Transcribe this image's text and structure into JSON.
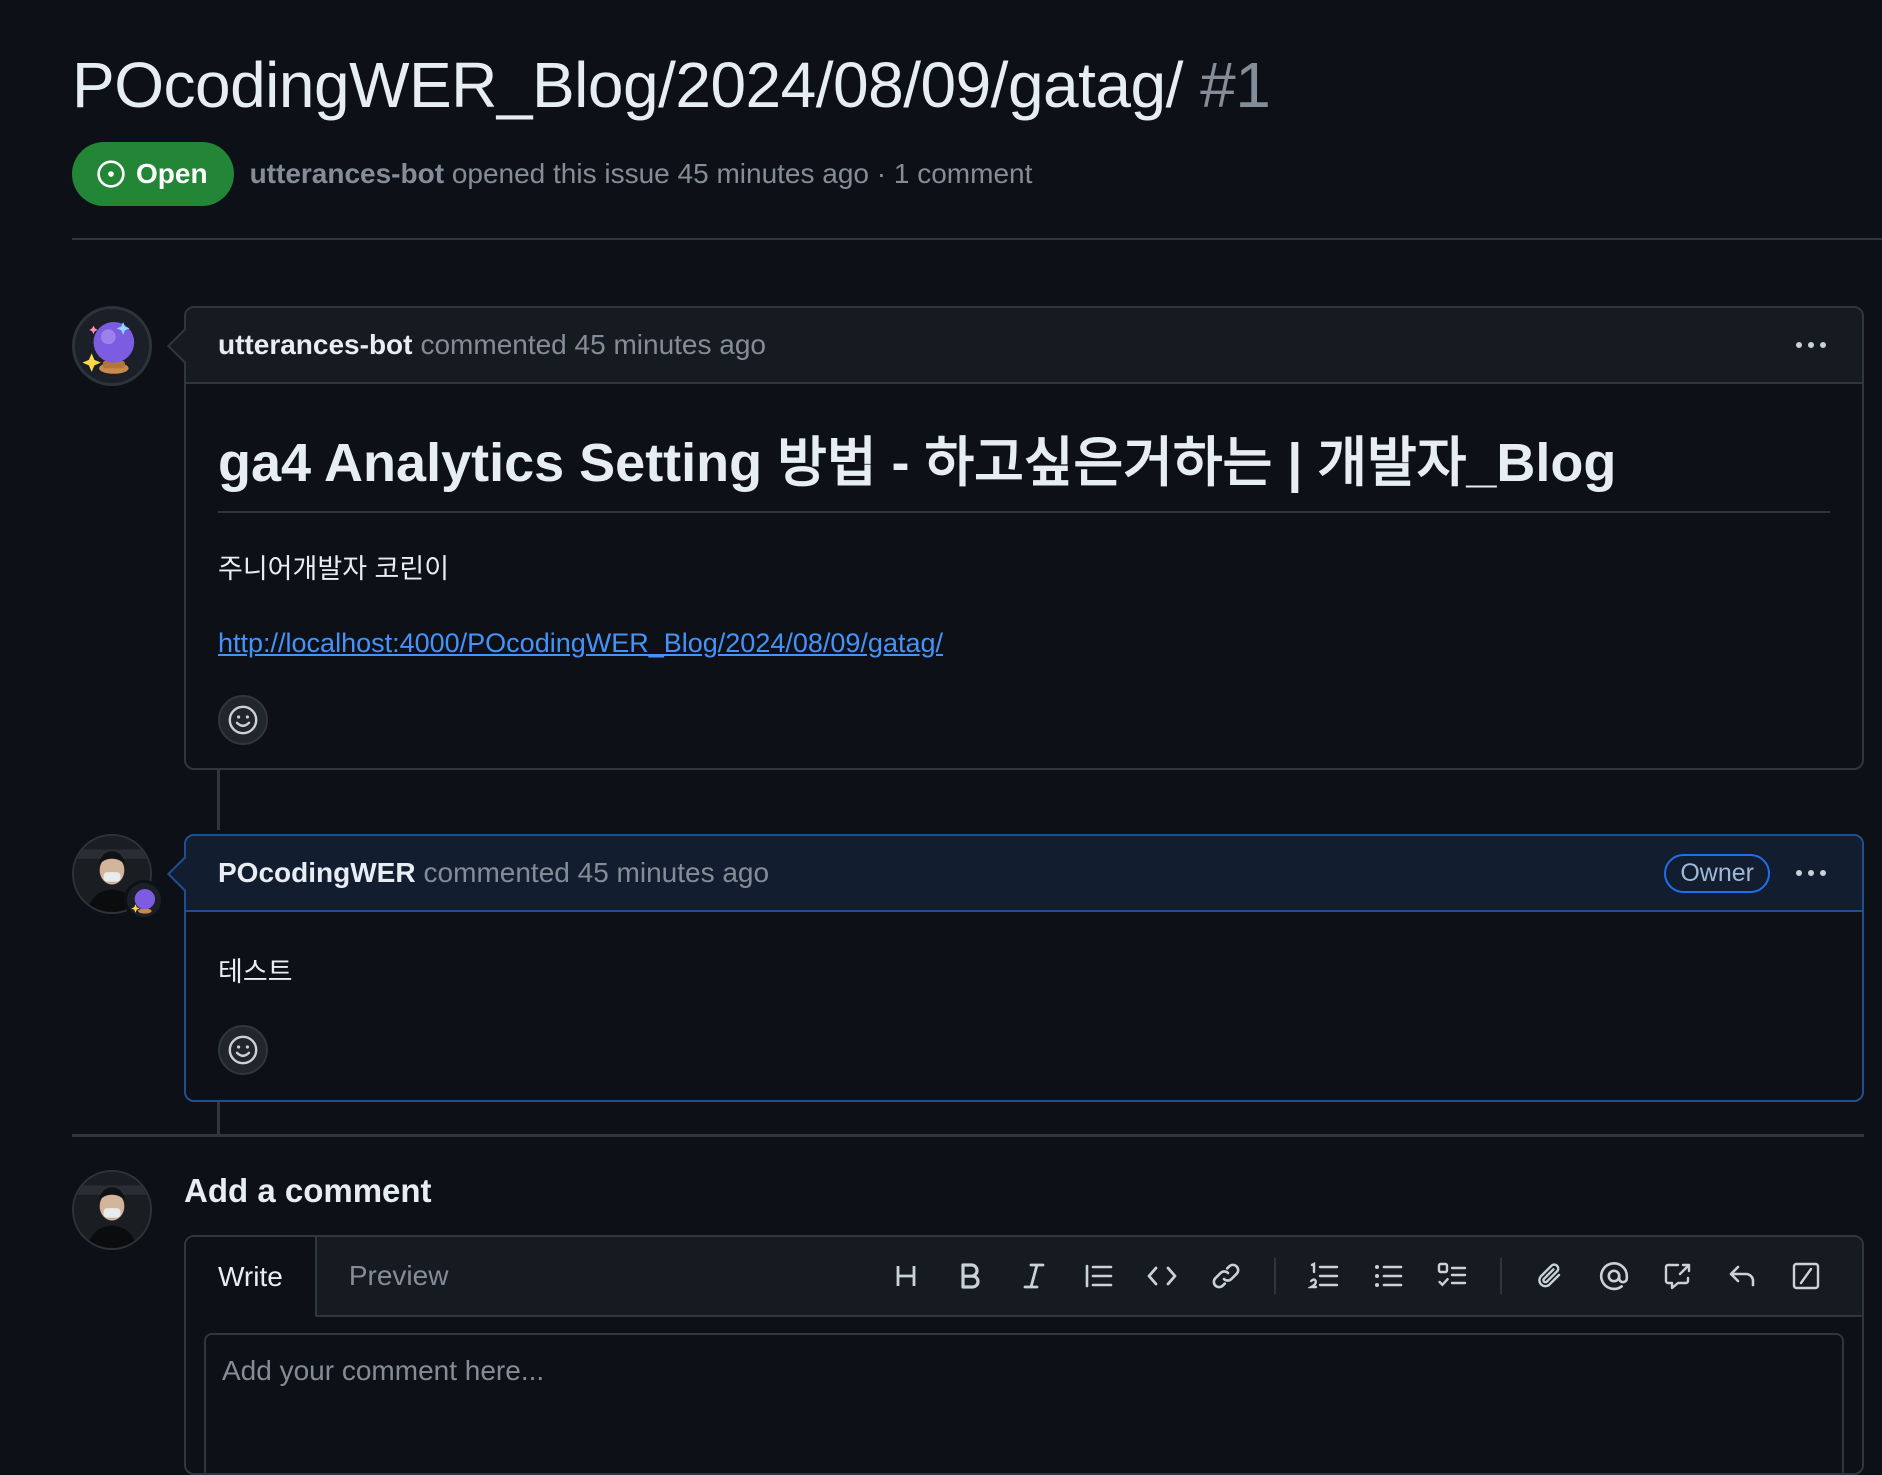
{
  "issue": {
    "title": "POcodingWER_Blog/2024/08/09/gatag/",
    "number": "#1",
    "state": "Open",
    "author": "utterances-bot",
    "meta": "opened this issue 45 minutes ago · 1 comment"
  },
  "comments": [
    {
      "author": "utterances-bot",
      "action": "commented 45 minutes ago",
      "heading": "ga4 Analytics Setting 방법 - 하고싶은거하는 | 개발자_Blog",
      "paragraph": "주니어개발자 코린이",
      "link": "http://localhost:4000/POcodingWER_Blog/2024/08/09/gatag/"
    },
    {
      "author": "POcodingWER",
      "action": "commented 45 minutes ago",
      "badge": "Owner",
      "paragraph": "테스트"
    }
  ],
  "new_comment": {
    "heading": "Add a comment",
    "tabs": [
      "Write",
      "Preview"
    ],
    "placeholder": "Add your comment here..."
  },
  "icons": {
    "toolbar": [
      "heading-icon",
      "bold-icon",
      "italic-icon",
      "quote-icon",
      "code-icon",
      "link-icon",
      "numbered-list-icon",
      "bulleted-list-icon",
      "task-list-icon",
      "attach-icon",
      "mention-icon",
      "cross-reference-icon",
      "reply-icon",
      "slash-commands-icon"
    ]
  },
  "colors": {
    "background": "#0d1117",
    "open_badge": "#238636",
    "link": "#4493f8",
    "owner_border": "#1f6feb"
  }
}
